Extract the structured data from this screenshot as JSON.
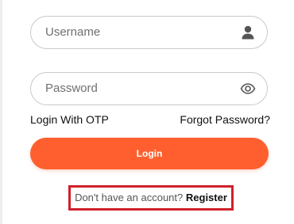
{
  "form": {
    "username": {
      "placeholder": "Username",
      "value": "",
      "icon": "user-icon"
    },
    "password": {
      "placeholder": "Password",
      "value": "",
      "icon": "eye-icon"
    },
    "otp_link": "Login With OTP",
    "forgot_link": "Forgot Password?",
    "login_label": "Login"
  },
  "register": {
    "prompt": "Don't have an account?",
    "link": "Register"
  },
  "colors": {
    "accent": "#ff5f2e",
    "highlight_border": "#d0202a"
  }
}
